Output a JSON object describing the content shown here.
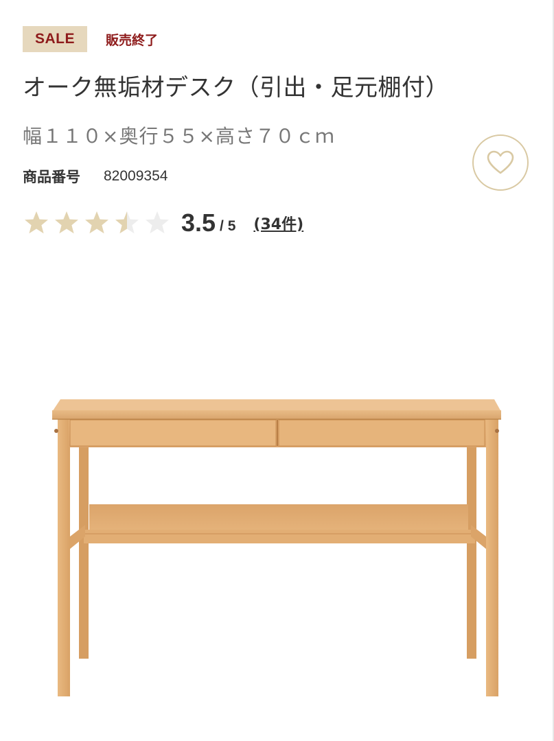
{
  "badge": {
    "sale_label": "SALE",
    "status": "販売終了"
  },
  "product": {
    "title": "オーク無垢材デスク（引出・足元棚付）",
    "size": "幅１１０×奥行５５×高さ７０ｃｍ",
    "number_label": "商品番号",
    "number_value": "82009354"
  },
  "rating": {
    "value": "3.5",
    "max": "/ 5",
    "score": 3.5,
    "stars_total": 5,
    "reviews": "(34件)"
  },
  "icons": {
    "favorite": "heart-icon",
    "star": "star-icon"
  },
  "colors": {
    "sale_bg": "#e6d8bd",
    "sale_text": "#8e1b1b",
    "star_filled": "#e2d3b0",
    "star_empty": "#ededed",
    "heart_outline": "#d9c9a3"
  }
}
